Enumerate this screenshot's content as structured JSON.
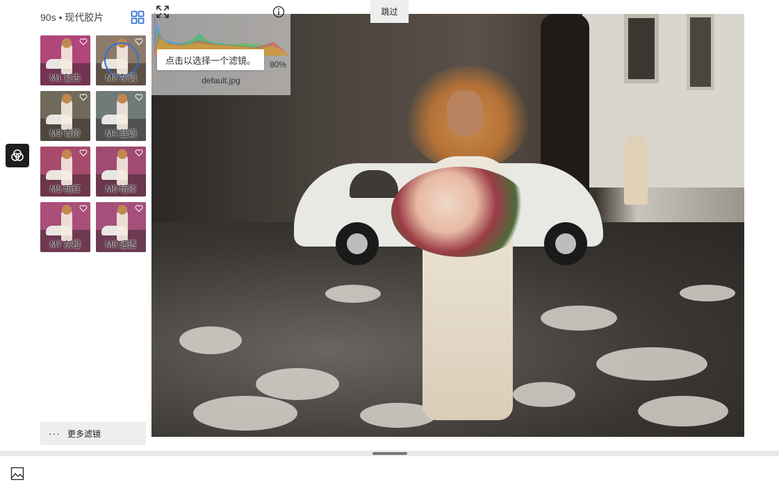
{
  "panel": {
    "title": "90s • 现代胶片",
    "layout_icon": "grid-view-icon",
    "filters": [
      {
        "label": "M1 复古",
        "tint": "#b0467a",
        "selected": false
      },
      {
        "label": "M2 灰调",
        "tint": "#8c7a6a",
        "selected": true
      },
      {
        "label": "M3 青阶",
        "tint": "#6f6a5a",
        "selected": false
      },
      {
        "label": "M4 蓝调",
        "tint": "#707a78",
        "selected": false
      },
      {
        "label": "M5 暗红",
        "tint": "#a84a6e",
        "selected": false
      },
      {
        "label": "M6 暗淡",
        "tint": "#a04c72",
        "selected": false
      },
      {
        "label": "M7 灰橙",
        "tint": "#a94f7a",
        "selected": false
      },
      {
        "label": "M8 通透",
        "tint": "#a4507a",
        "selected": false
      }
    ],
    "more_dots": "···",
    "more_label": "更多滤镜"
  },
  "overlay": {
    "tooltip": "点击以选择一个滤镜。",
    "zoom_text": "80%",
    "filename": "default.jpg"
  },
  "toolbar": {
    "skip_label": "跳过"
  },
  "icons": {
    "rail": "filter-rings-icon",
    "expand": "expand-icon",
    "info": "info-icon",
    "bottom": "image-icon"
  },
  "colors": {
    "accent": "#2f6fd6",
    "rail_button": "#1e1e1e",
    "panel_button": "#eeeeee"
  }
}
